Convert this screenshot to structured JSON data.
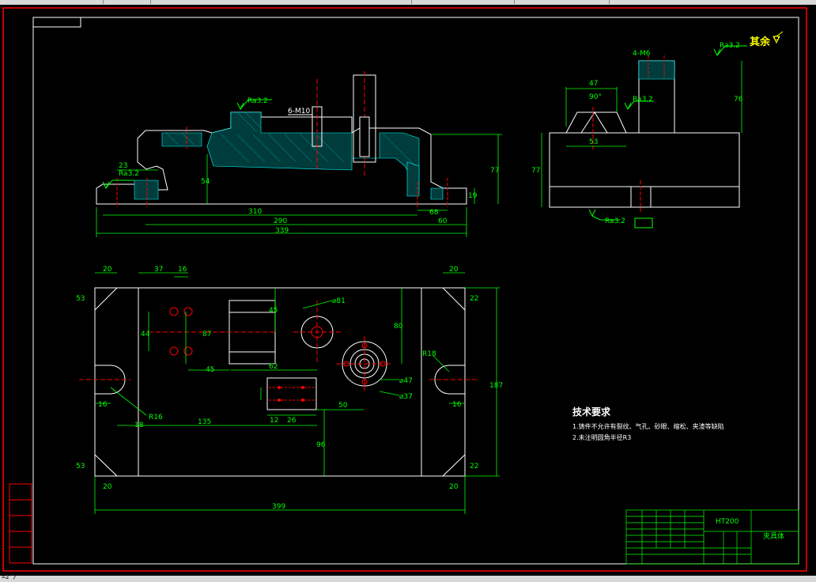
{
  "top_note": {
    "text": "其余",
    "color": "#ffff00"
  },
  "tech": {
    "title": "技术要求",
    "line1": "1.铸件不允许有裂纹、气孔、砂眼、缩松、夹渣等缺陷",
    "line2": "2.未注明圆角半径R3"
  },
  "title_block": {
    "material": "HT200",
    "part_name": "夹具体"
  },
  "left_table": [
    "",
    "",
    "",
    "",
    "",
    ""
  ],
  "roughness": [
    "Ra3.2",
    "Ra3.2",
    "Ra3.2",
    "Ra3.2",
    "Ra3.2",
    "Ra3.2",
    "Ra6.3"
  ],
  "dims_front": {
    "d310": "310",
    "d290": "290",
    "d339": "339",
    "d60": "60",
    "d68": "68",
    "d23": "23",
    "d54": "54",
    "d77": "77",
    "d19": "19",
    "d6m10": "6-M10"
  },
  "dims_side": {
    "d47": "47",
    "d90": "90°",
    "d53": "53",
    "d77": "77",
    "d76": "76",
    "d4m6": "4-M6"
  },
  "dims_plan": {
    "d20a": "20",
    "d37": "37",
    "d16": "16",
    "d20b": "20",
    "d53": "53",
    "d22a": "22",
    "d44": "44",
    "d45": "45",
    "d87": "87",
    "d81": "⌀81",
    "d80": "80",
    "d62": "62",
    "d47": "⌀47",
    "d37b": "⌀37",
    "d187": "187",
    "dr18": "R18",
    "d16b": "16",
    "d16c": "16",
    "d135": "135",
    "d12": "12",
    "d26": "26",
    "d50": "50",
    "d96": "96",
    "dr16": "R16",
    "d18": "18",
    "d53b": "53",
    "d22b": "22",
    "d20c": "20",
    "d20d": "20",
    "d399": "399"
  },
  "status_text": "=2 /",
  "colors": {
    "outline": "#ffffff",
    "dimension": "#00ff00",
    "hatch": "#00ffff",
    "hole": "#ff0000",
    "frame": "#ff0000",
    "note": "#ffff00"
  }
}
